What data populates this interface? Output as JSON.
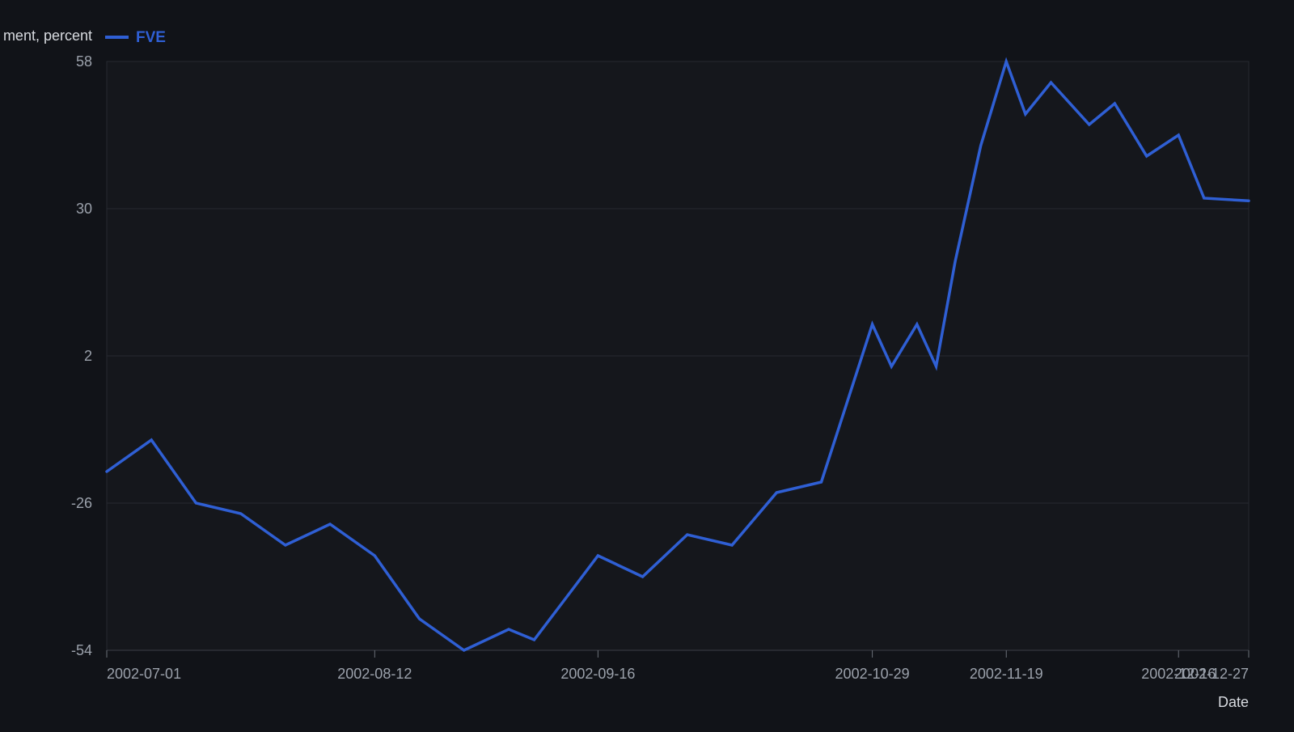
{
  "chart_data": {
    "type": "line",
    "ylabel": "ment, percent",
    "xlabel": "Date",
    "ylim": [
      -54,
      58
    ],
    "y_ticks": [
      "58",
      "30",
      "2",
      "-26",
      "-54"
    ],
    "x_tick_labels": [
      "2002-07-01",
      "2002-08-12",
      "2002-09-16",
      "2002-10-29",
      "2002-11-19",
      "2002-12-16",
      "2002-12-27"
    ],
    "grid": true,
    "legend_position": "top-left",
    "series": [
      {
        "name": "FVE",
        "color": "#2f5fd4",
        "x": [
          "2002-07-01",
          "2002-07-08",
          "2002-07-15",
          "2002-07-22",
          "2002-07-29",
          "2002-08-05",
          "2002-08-12",
          "2002-08-19",
          "2002-08-26",
          "2002-09-02",
          "2002-09-06",
          "2002-09-11",
          "2002-09-16",
          "2002-09-23",
          "2002-09-30",
          "2002-10-07",
          "2002-10-14",
          "2002-10-21",
          "2002-10-29",
          "2002-11-01",
          "2002-11-05",
          "2002-11-08",
          "2002-11-11",
          "2002-11-15",
          "2002-11-19",
          "2002-11-22",
          "2002-11-26",
          "2002-12-02",
          "2002-12-06",
          "2002-12-11",
          "2002-12-16",
          "2002-12-20",
          "2002-12-27"
        ],
        "y": [
          -20,
          -14,
          -26,
          -28,
          -34,
          -30,
          -36,
          -48,
          -54,
          -50,
          -52,
          -44,
          -36,
          -40,
          -32,
          -34,
          -24,
          -22,
          8,
          0,
          8,
          0,
          20,
          42,
          58,
          48,
          54,
          46,
          50,
          40,
          44,
          32,
          31.5
        ]
      }
    ]
  }
}
